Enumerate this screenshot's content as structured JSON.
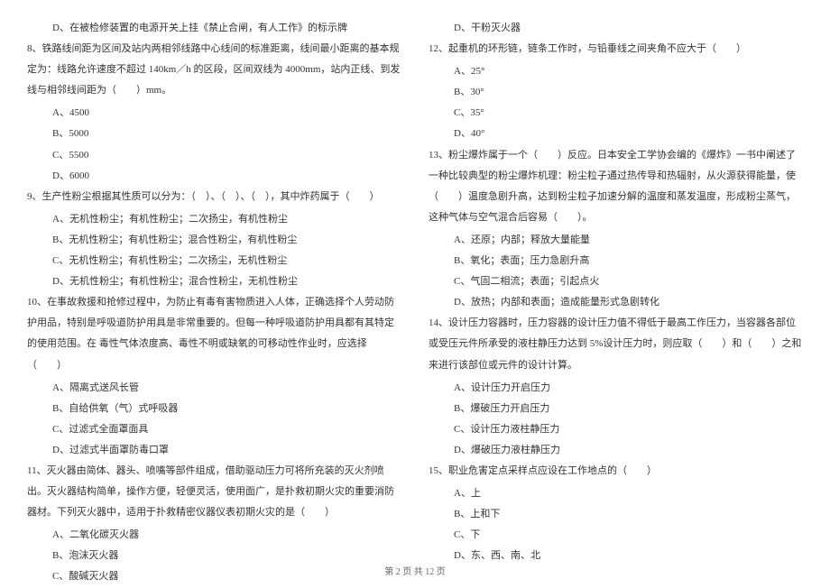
{
  "left": {
    "l7d": "D、在被检修装置的电源开关上挂《禁止合闸，有人工作》的标示牌",
    "q8": "8、铁路线间距为区间及站内两相邻线路中心线间的标准距离，线间最小距离的基本规定为：线路允许速度不超过 140km／h 的区段，区间双线为 4000mm，站内正线、到发线与相邻线间距为（　　）mm。",
    "q8a": "A、4500",
    "q8b": "B、5000",
    "q8c": "C、5500",
    "q8d": "D、6000",
    "q9": "9、生产性粉尘根据其性质可以分为：（　）、（　）、（　），其中炸药属于（　　）",
    "q9a": "A、无机性粉尘；有机性粉尘；二次扬尘，有机性粉尘",
    "q9b": "B、无机性粉尘；有机性粉尘；混合性粉尘，有机性粉尘",
    "q9c": "C、无机性粉尘；有机性粉尘；二次扬尘，无机性粉尘",
    "q9d": "D、无机性粉尘；有机性粉尘；混合性粉尘，无机性粉尘",
    "q10": "10、在事故救援和抢修过程中，为防止有毒有害物质进入人体，正确选择个人劳动防护用品，特别是呼吸道防护用具是非常重要的。但每一种呼吸道防护用具都有其特定的使用范围。在 毒性气体浓度高、毒性不明或缺氧的可移动性作业时，应选择（　　）",
    "q10a": "A、隔离式送风长管",
    "q10b": "B、自给供氧（气）式呼吸器",
    "q10c": "C、过滤式全面罩面具",
    "q10d": "D、过滤式半面罩防毒口罩",
    "q11": "11、灭火器由简体、器头、喷嘴等部件组成，借助驱动压力可将所充装的灭火剂喷出。灭火器结构简单，操作方便，轻便灵活，使用面广，是扑救初期火灾的重要消防器材。下列灭火器中，适用于扑救精密仪器仪表初期火灾的是（　　）",
    "q11a": "A、二氧化碳灭火器",
    "q11b": "B、泡沫灭火器",
    "q11c": "C、酸碱灭火器"
  },
  "right": {
    "q11d": "D、干粉灭火器",
    "q12": "12、起重机的环形链，链条工作时，与铅垂线之间夹角不应大于（　　）",
    "q12a": "A、25°",
    "q12b": "B、30°",
    "q12c": "C、35°",
    "q12d": "D、40°",
    "q13": "13、粉尘爆炸属于一个（　　）反应。日本安全工学协会编的《爆炸》一书中阐述了一种比较典型的粉尘爆炸机理：粉尘粒子通过热传导和热辐射，从火源获得能量，使（　　）温度急剧升高，达到粉尘粒子加速分解的温度和蒸发温度，形成粉尘蒸气，这种气体与空气混合后容易（　　）。",
    "q13a": "A、还原；内部；释放大量能量",
    "q13b": "B、氧化；表面；压力急剧升高",
    "q13c": "C、气固二相流；表面；引起点火",
    "q13d": "D、放热；内部和表面；造成能量形式急剧转化",
    "q14": "14、设计压力容器时，压力容器的设计压力值不得低于最高工作压力，当容器各部位或受压元件所承受的液柱静压力达到 5%设计压力时，则应取（　　）和（　　）之和来进行该部位或元件的设计计算。",
    "q14a": "A、设计压力开启压力",
    "q14b": "B、爆破压力开启压力",
    "q14c": "C、设计压力液柱静压力",
    "q14d": "D、爆破压力液柱静压力",
    "q15": "15、职业危害定点采样点应设在工作地点的（　　）",
    "q15a": "A、上",
    "q15b": "B、上和下",
    "q15c": "C、下",
    "q15d": "D、东、西、南、北"
  },
  "footer": "第 2 页 共 12 页"
}
